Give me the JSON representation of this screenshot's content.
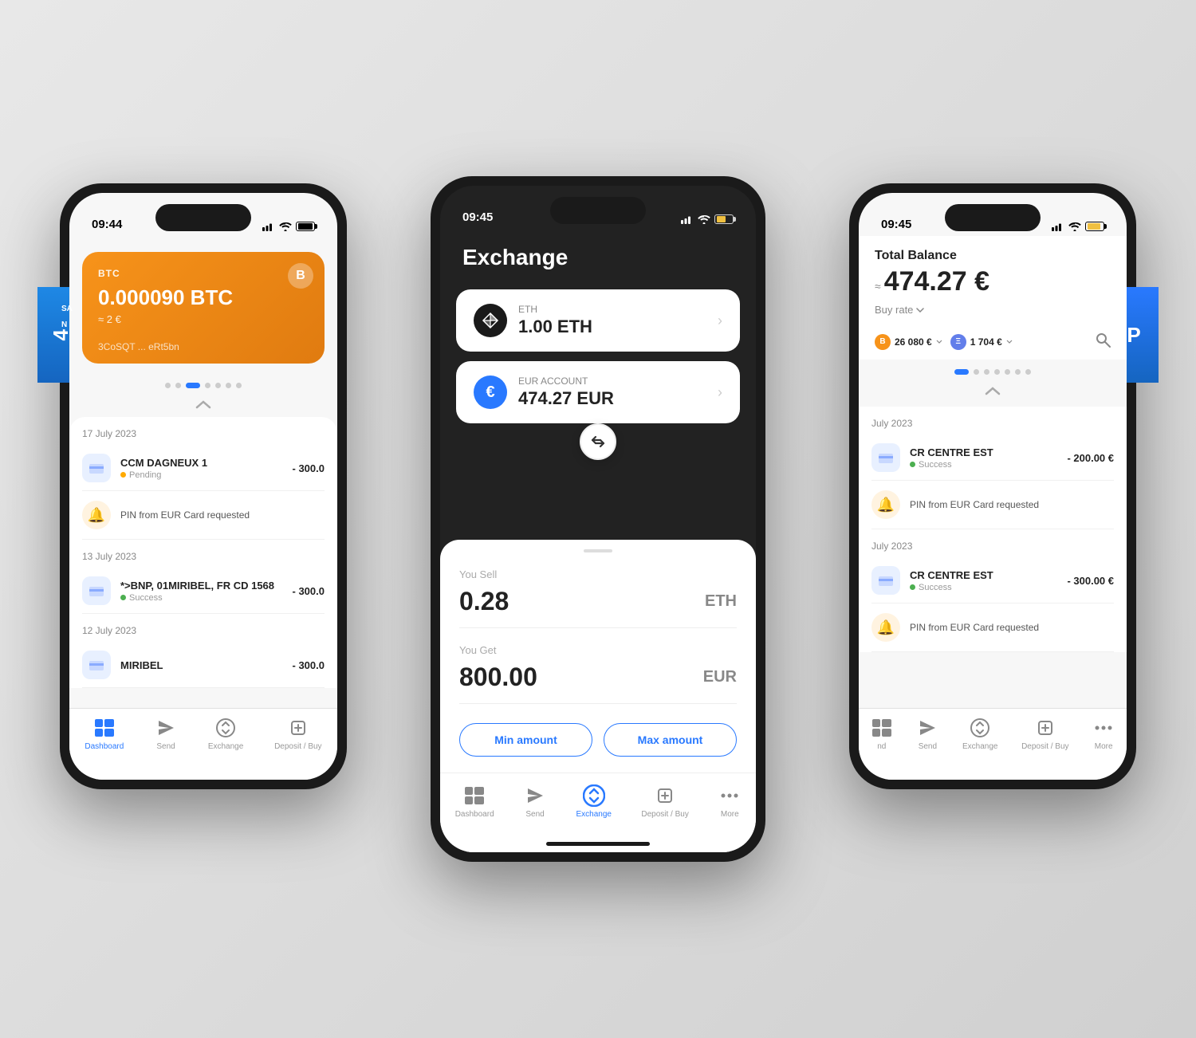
{
  "scene": {
    "background": "#e0e0e0"
  },
  "leftPhone": {
    "statusBar": {
      "time": "09:44",
      "signal": "▲▲▲",
      "wifi": "wifi",
      "battery": ""
    },
    "card": {
      "currency": "BTC",
      "btcIcon": "B",
      "amount": "0.000090 BTC",
      "fiatApprox": "≈ 2 €",
      "address": "3CoSQT ... eRt5bn"
    },
    "transactions": [
      {
        "date": "17 July 2023",
        "items": [
          {
            "name": "CCM DAGNEUX 1",
            "status": "Pending",
            "statusType": "pending",
            "amount": "- 300.0"
          }
        ],
        "notifications": [
          {
            "text": "PIN from EUR Card requested"
          }
        ]
      },
      {
        "date": "13 July 2023",
        "items": [
          {
            "name": "*>BNP, 01MIRIBEL, FR CD 1568",
            "status": "Success",
            "statusType": "success",
            "amount": "- 300.0"
          }
        ],
        "notifications": []
      },
      {
        "date": "12 July 2023",
        "items": [
          {
            "name": "MIRIBEL",
            "status": "",
            "statusType": "",
            "amount": "- 300.0"
          }
        ]
      }
    ],
    "nav": {
      "items": [
        {
          "label": "Dashboard",
          "icon": "dashboard",
          "active": false
        },
        {
          "label": "Send",
          "icon": "send",
          "active": false
        },
        {
          "label": "Exchange",
          "icon": "exchange",
          "active": false
        },
        {
          "label": "Deposit / Buy",
          "icon": "deposit",
          "active": false
        }
      ]
    }
  },
  "centerPhone": {
    "statusBar": {
      "time": "09:45",
      "signal": "▲▲▲",
      "wifi": "wifi",
      "battery": ""
    },
    "title": "Exchange",
    "fromCard": {
      "currency": "ETH",
      "icon": "ethereum",
      "value": "1.00 ETH"
    },
    "toCard": {
      "label": "EUR ACCOUNT",
      "icon": "euro",
      "value": "474.27 EUR"
    },
    "sellLabel": "You Sell",
    "sellAmount": "0.28",
    "sellCurrency": "ETH",
    "getLabel": "You Get",
    "getAmount": "800.00",
    "getCurrency": "EUR",
    "minAmountBtn": "Min amount",
    "maxAmountBtn": "Max amount",
    "exchangeBtn": "Exchange",
    "nav": {
      "items": [
        {
          "label": "Dashboard",
          "icon": "dashboard",
          "active": false
        },
        {
          "label": "Send",
          "icon": "send",
          "active": false
        },
        {
          "label": "Exchange",
          "icon": "exchange",
          "active": true
        },
        {
          "label": "Deposit / Buy",
          "icon": "deposit",
          "active": false
        },
        {
          "label": "More",
          "icon": "more",
          "active": false
        }
      ]
    }
  },
  "rightPhone": {
    "statusBar": {
      "time": "09:45",
      "signal": "▲▲▲",
      "wifi": "wifi",
      "batteryFull": true
    },
    "totalBalance": "Total Balance",
    "balanceAmount": "474.27 €",
    "approxSymbol": "≈",
    "buyRate": "Buy rate",
    "btcPrice": "26 080 €",
    "ethPrice": "1 704 €",
    "transactions": [
      {
        "date": "July 2023",
        "items": [
          {
            "name": "CR CENTRE EST",
            "status": "Success",
            "statusType": "success",
            "amount": "- 200.00 €"
          }
        ],
        "notifications": [
          {
            "text": "PIN from EUR Card requested"
          }
        ]
      },
      {
        "date": "July 2023",
        "items": [
          {
            "name": "CR CENTRE EST",
            "status": "Success",
            "statusType": "success",
            "amount": "- 300.00 €"
          }
        ],
        "notifications": [
          {
            "text": "PIN from EUR Card requested"
          }
        ]
      }
    ],
    "nav": {
      "items": [
        {
          "label": "nd",
          "icon": "dashboard",
          "active": false
        },
        {
          "label": "Send",
          "icon": "send",
          "active": false
        },
        {
          "label": "Exchange",
          "icon": "exchange",
          "active": false
        },
        {
          "label": "Deposit / Buy",
          "icon": "deposit",
          "active": false
        },
        {
          "label": "More",
          "icon": "more",
          "active": false
        }
      ]
    },
    "blueCard": {
      "number": "4"
    }
  }
}
